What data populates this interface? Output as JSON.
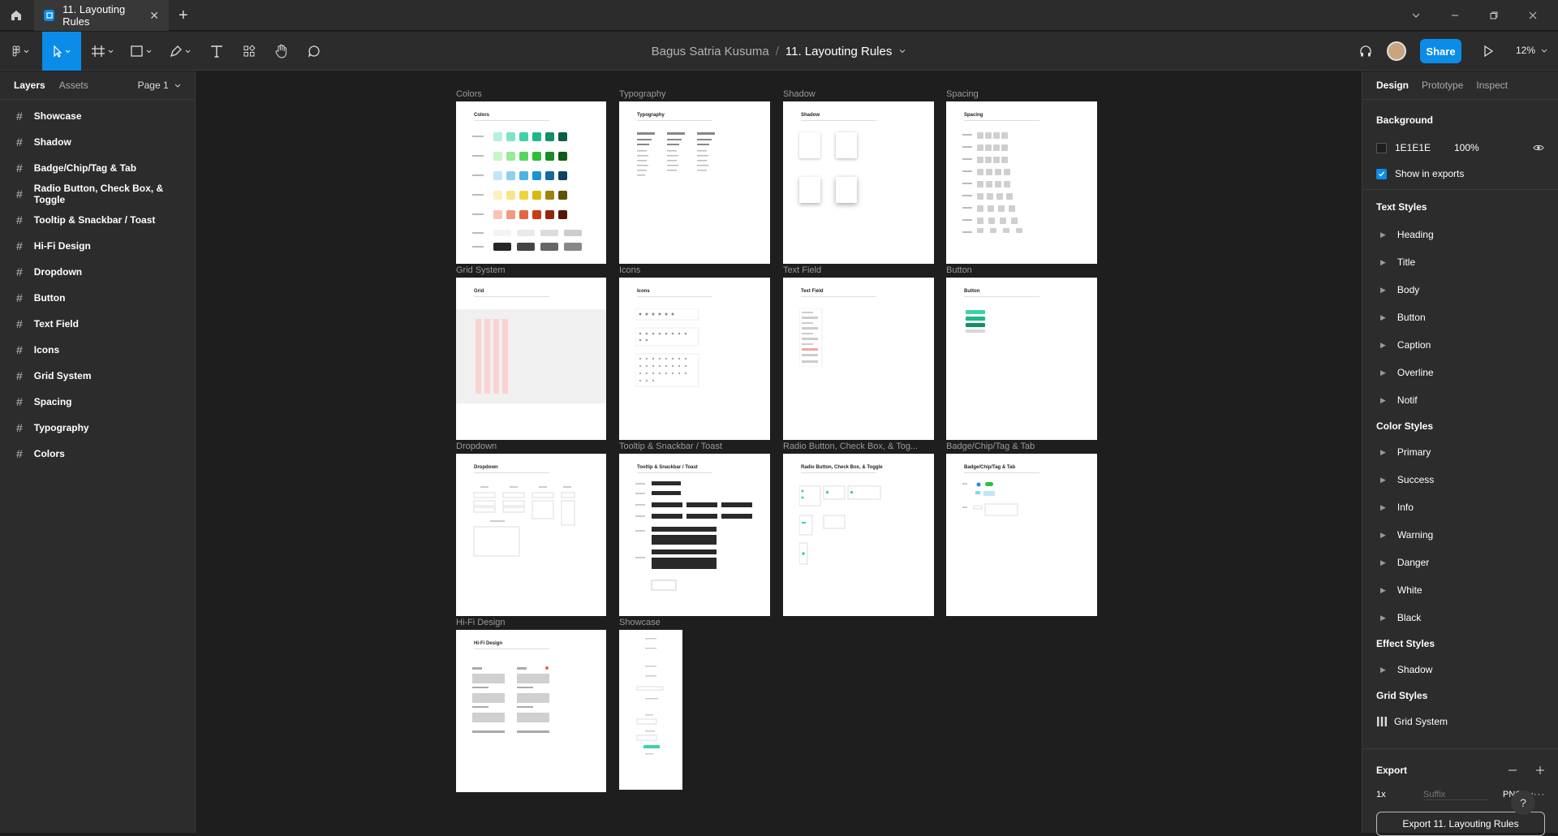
{
  "window": {
    "tab_title": "11. Layouting Rules",
    "tab_close": "✕",
    "new_tab": "+"
  },
  "toolbar": {
    "owner": "Bagus Satria Kusuma",
    "separator": "/",
    "file_name": "11. Layouting Rules",
    "share_label": "Share",
    "zoom": "12%"
  },
  "left_panel": {
    "tab_layers": "Layers",
    "tab_assets": "Assets",
    "page": "Page 1",
    "layers": [
      "Showcase",
      "Shadow",
      "Badge/Chip/Tag & Tab",
      "Radio Button, Check Box, & Toggle",
      "Tooltip & Snackbar / Toast",
      "Hi-Fi Design",
      "Dropdown",
      "Button",
      "Text Field",
      "Icons",
      "Grid System",
      "Spacing",
      "Typography",
      "Colors"
    ]
  },
  "canvas": {
    "frames": [
      {
        "label": "Colors",
        "title": "Colors"
      },
      {
        "label": "Typography",
        "title": "Typography"
      },
      {
        "label": "Shadow",
        "title": "Shadow"
      },
      {
        "label": "Spacing",
        "title": "Spacing"
      },
      {
        "label": "Grid System",
        "title": "Grid"
      },
      {
        "label": "Icons",
        "title": "Icons"
      },
      {
        "label": "Text Field",
        "title": "Text Field"
      },
      {
        "label": "Button",
        "title": "Button"
      },
      {
        "label": "Dropdown",
        "title": "Dropdown"
      },
      {
        "label": "Tooltip & Snackbar / Toast",
        "title": "Tooltip & Snackbar / Toast"
      },
      {
        "label": "Radio Button, Check Box, & Tog...",
        "title": "Radio Button, Check Box, & Toggle"
      },
      {
        "label": "Badge/Chip/Tag & Tab",
        "title": "Badge/Chip/Tag & Tab"
      },
      {
        "label": "Hi-Fi Design",
        "title": "Hi-Fi Design"
      },
      {
        "label": "Showcase",
        "title": ""
      }
    ],
    "palette": [
      "#b7f0e0",
      "#7fe3c8",
      "#3fd1a8",
      "#1db88a",
      "#138f6a",
      "#0b5e45"
    ]
  },
  "right_panel": {
    "tab_design": "Design",
    "tab_prototype": "Prototype",
    "tab_inspect": "Inspect",
    "background_title": "Background",
    "bg_hex": "1E1E1E",
    "bg_opacity": "100%",
    "bg_color": "#1e1e1e",
    "show_exports": "Show in exports",
    "text_styles_title": "Text Styles",
    "text_styles": [
      "Heading",
      "Title",
      "Body",
      "Button",
      "Caption",
      "Overline",
      "Notif"
    ],
    "color_styles_title": "Color Styles",
    "color_styles": [
      "Primary",
      "Success",
      "Info",
      "Warning",
      "Danger",
      "White",
      "Black"
    ],
    "effect_styles_title": "Effect Styles",
    "effect_styles": [
      "Shadow"
    ],
    "grid_styles_title": "Grid Styles",
    "grid_styles": [
      "Grid System"
    ],
    "export_title": "Export",
    "export_scale": "1x",
    "export_suffix_placeholder": "Suffix",
    "export_format": "PNG",
    "export_button": "Export 11. Layouting Rules"
  },
  "help": "?"
}
